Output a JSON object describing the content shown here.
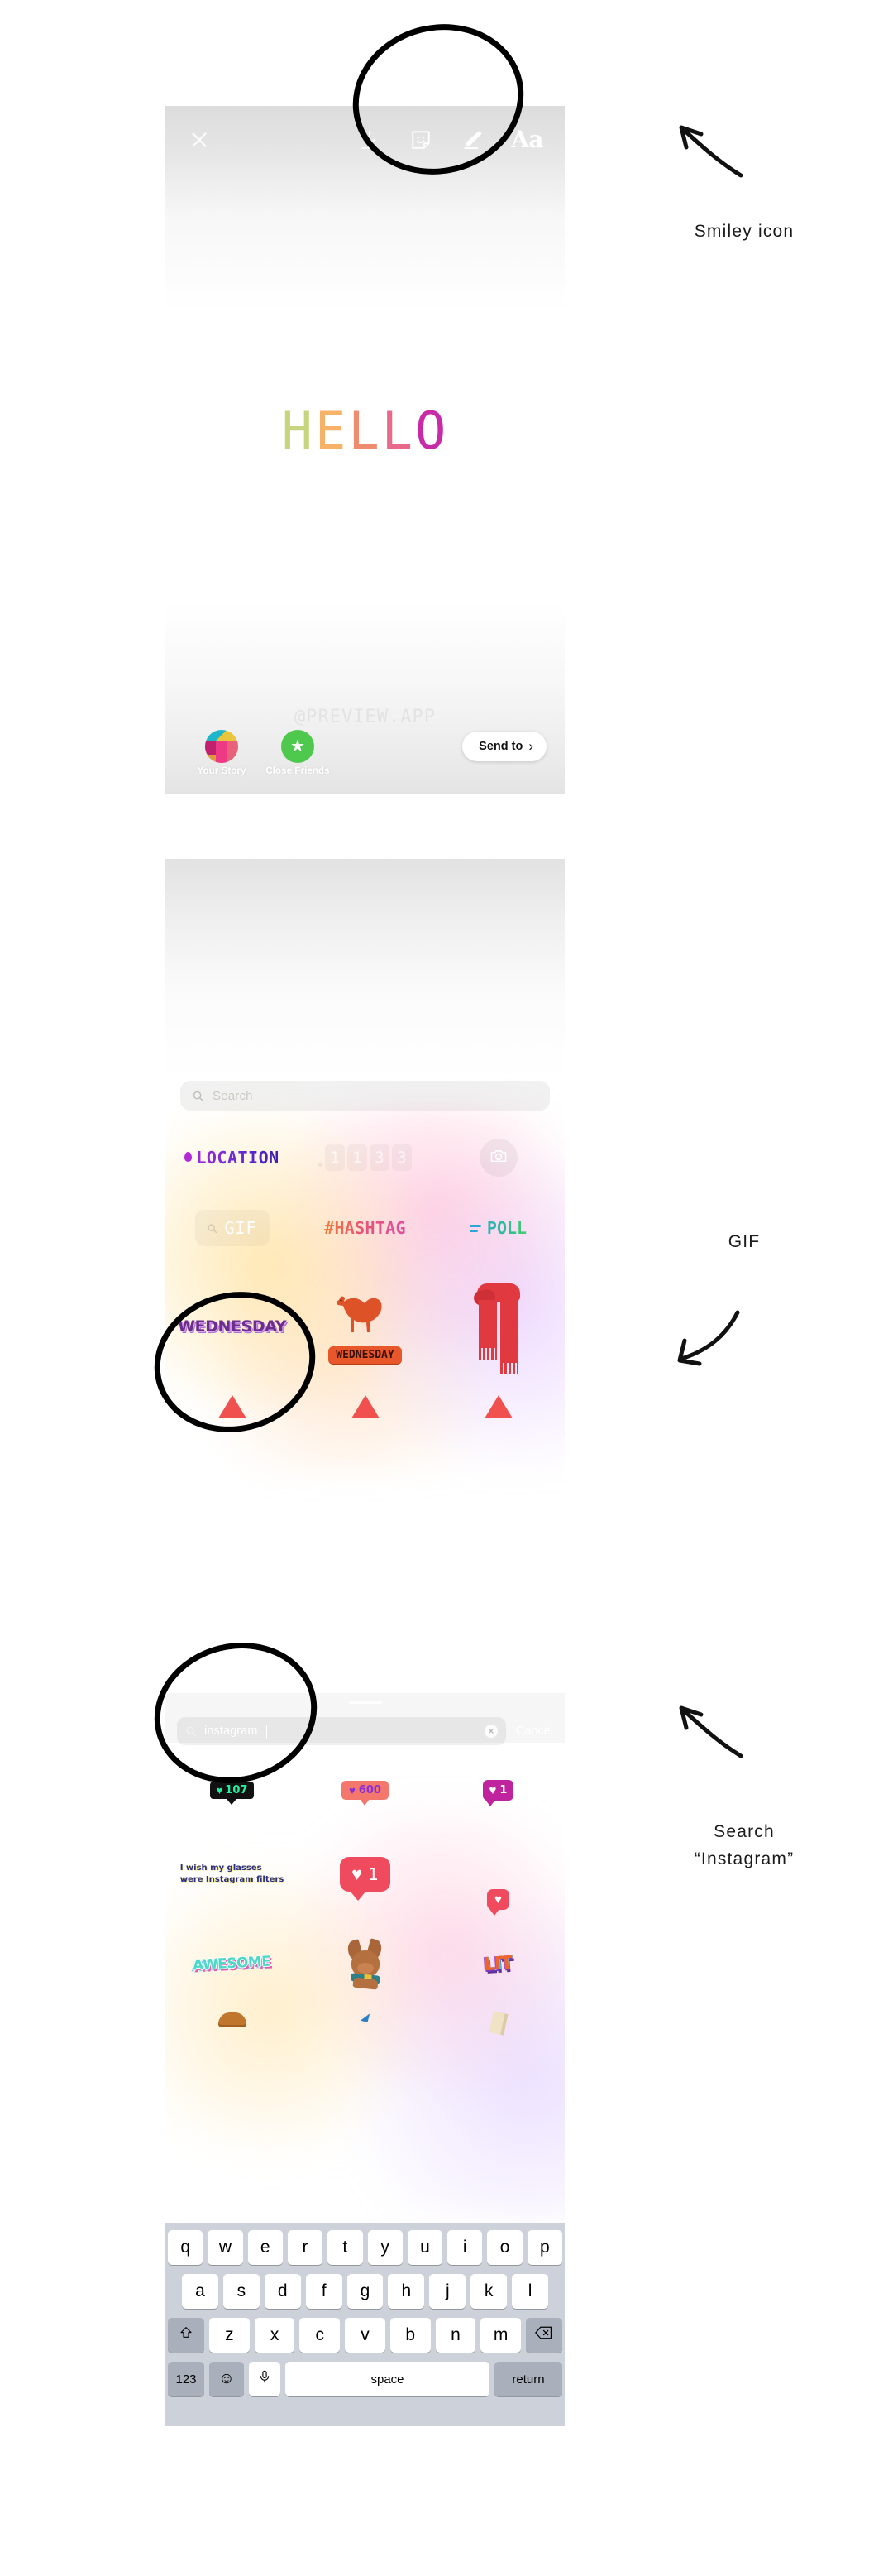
{
  "screen1": {
    "name": "instagram-story-editor",
    "toolbar": {
      "close_label": "×",
      "icons": [
        "download-icon",
        "sticker-smiley-icon",
        "draw-pen-icon"
      ],
      "text_tool_label": "Aa"
    },
    "canvas_text": {
      "full": "HELLO",
      "letters": [
        {
          "char": "H",
          "color": "#c7d67e"
        },
        {
          "char": "E",
          "color": "#f6b267"
        },
        {
          "char": "L",
          "color": "#ef8b6f"
        },
        {
          "char": "L",
          "color": "#e8698c"
        },
        {
          "char": "O",
          "color": "#c92aa8"
        }
      ]
    },
    "watermark": "@PREVIEW.APP",
    "bottom_bar": {
      "your_story_label": "Your Story",
      "close_friends_label": "Close Friends",
      "send_to_label": "Send to",
      "send_to_chevron": "›"
    }
  },
  "screen2": {
    "name": "sticker-tray",
    "search": {
      "placeholder": "Search",
      "icon": "search-icon"
    },
    "stickers_row1": [
      {
        "name": "location-sticker",
        "label": "LOCATION"
      },
      {
        "name": "time-sticker",
        "label": "11:33",
        "digits": [
          "1",
          "1",
          "3",
          "3"
        ]
      },
      {
        "name": "camera-sticker",
        "label": "camera-icon"
      }
    ],
    "stickers_row2": [
      {
        "name": "gif-sticker",
        "label": "GIF"
      },
      {
        "name": "hashtag-sticker",
        "label": "#HASHTAG"
      },
      {
        "name": "poll-sticker",
        "label": "POLL"
      }
    ],
    "stickers_row3": [
      {
        "name": "wednesday-text-sticker",
        "label": "WEDNESDAY"
      },
      {
        "name": "camel-wednesday-sticker",
        "label": "WEDNESDAY"
      },
      {
        "name": "red-scarf-sticker",
        "label": ""
      }
    ],
    "stickers_row4": [
      {
        "name": "red-triangle-sticker",
        "label": ""
      },
      {
        "name": "red-triangle-sticker",
        "label": ""
      },
      {
        "name": "red-triangle-sticker",
        "label": ""
      }
    ]
  },
  "screen3": {
    "name": "gif-search",
    "search": {
      "value": "instagram",
      "icon": "search-icon",
      "clear_label": "×",
      "cancel_label": "Cancel"
    },
    "results_row1": [
      {
        "name": "like-badge-gif",
        "count": "107",
        "color": "#111111"
      },
      {
        "name": "like-badge-gif",
        "count": "600",
        "color": "#f4776e"
      },
      {
        "name": "like-badge-gif",
        "count": "1",
        "color": "#c0239e"
      }
    ],
    "results_row2": [
      {
        "name": "quote-gif",
        "line1": "I wish my glasses",
        "line2": "were Instagram filters"
      },
      {
        "name": "like-badge-gif",
        "count": "1",
        "color": "#ef4a5e"
      },
      {
        "name": "heart-badge-gif",
        "count": "",
        "color": "#ef4a5e"
      }
    ],
    "results_row3": [
      {
        "name": "awesome-gif",
        "label": "AWESOME"
      },
      {
        "name": "chihuahua-gif",
        "label": ""
      },
      {
        "name": "lit-gif",
        "label": "LIT"
      }
    ],
    "keyboard": {
      "row1": [
        "q",
        "w",
        "e",
        "r",
        "t",
        "y",
        "u",
        "i",
        "o",
        "p"
      ],
      "row2": [
        "a",
        "s",
        "d",
        "f",
        "g",
        "h",
        "j",
        "k",
        "l"
      ],
      "row3": [
        "z",
        "x",
        "c",
        "v",
        "b",
        "n",
        "m"
      ],
      "shift_label": "shift-icon",
      "backspace_label": "backspace-icon",
      "numbers_label": "123",
      "emoji_label": "emoji-icon",
      "mic_label": "microphone-icon",
      "space_label": "space",
      "return_label": "return"
    }
  },
  "annotations": [
    {
      "name": "annotation-smiley-icon",
      "text": "Smiley icon"
    },
    {
      "name": "annotation-gif",
      "text": "GIF"
    },
    {
      "name": "annotation-search-instagram-line1",
      "text": "Search"
    },
    {
      "name": "annotation-search-instagram-line2",
      "text": "“Instagram”"
    }
  ]
}
